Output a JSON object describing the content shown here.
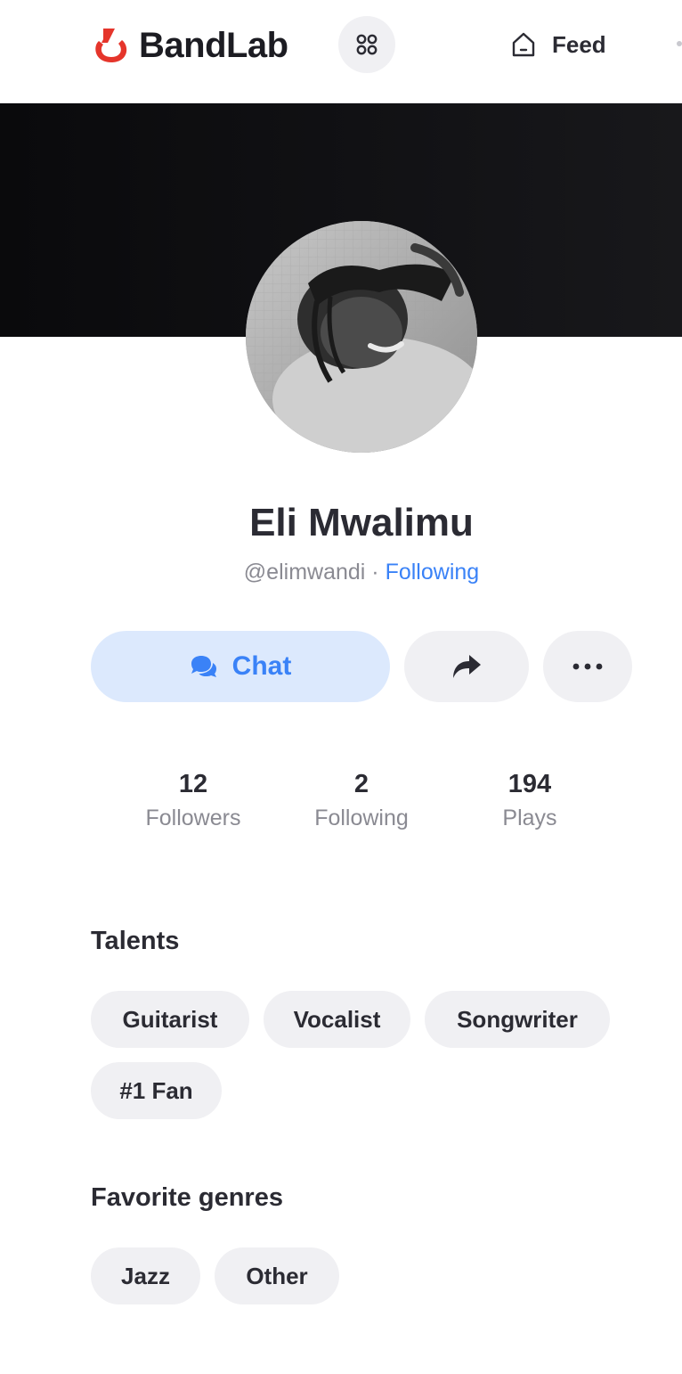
{
  "app": {
    "brand": "BandLab",
    "brand_color": "#e5352b",
    "nav": {
      "feed_label": "Feed"
    },
    "icons": {
      "apps": "apps-grid-icon",
      "feed": "home-icon",
      "chat": "chat-bubbles-icon",
      "share": "share-arrow-icon",
      "more": "more-dots-icon"
    }
  },
  "profile": {
    "name": "Eli Mwalimu",
    "handle": "@elimwandi",
    "separator": "·",
    "follow_status": "Following",
    "link_color": "#3a82f7"
  },
  "actions": {
    "chat_label": "Chat"
  },
  "stats": [
    {
      "value": "12",
      "label": "Followers"
    },
    {
      "value": "2",
      "label": "Following"
    },
    {
      "value": "194",
      "label": "Plays"
    }
  ],
  "talents": {
    "title": "Talents",
    "items": [
      "Guitarist",
      "Vocalist",
      "Songwriter",
      "#1 Fan"
    ]
  },
  "genres": {
    "title": "Favorite genres",
    "items": [
      "Jazz",
      "Other"
    ]
  }
}
